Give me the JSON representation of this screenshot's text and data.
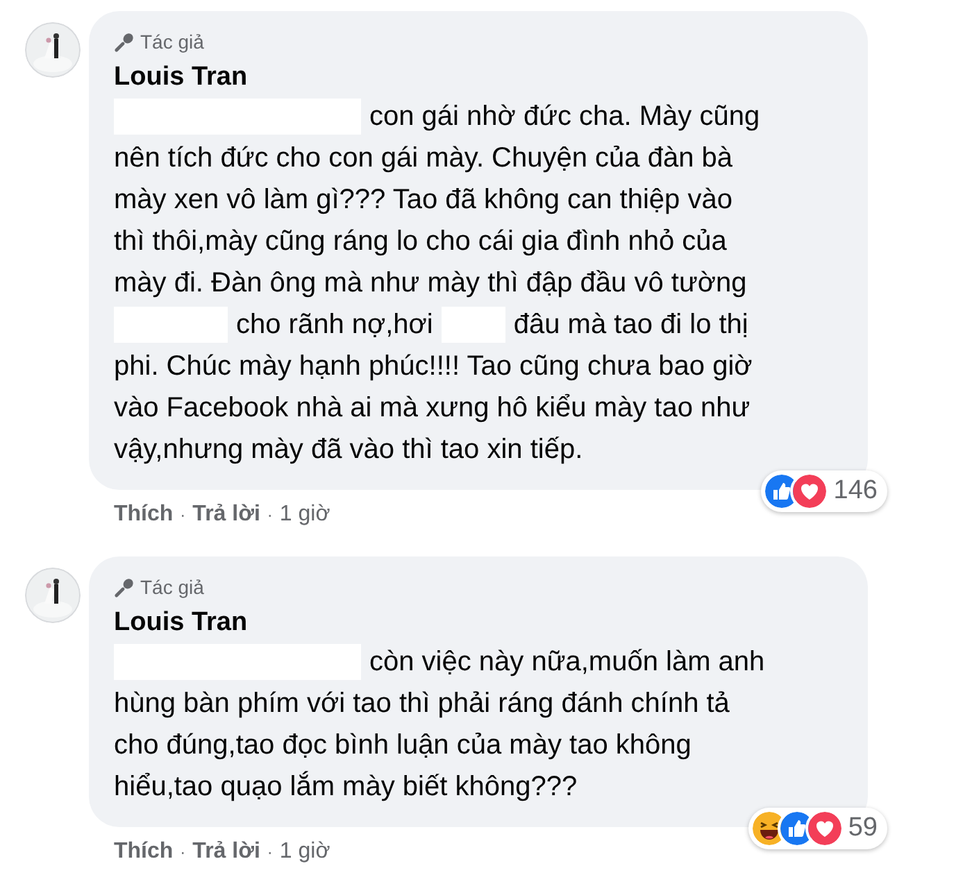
{
  "comments": [
    {
      "badge": "Tác giả",
      "author": "Louis Tran",
      "lines": [
        [
          {
            "kind": "redacted_wide"
          },
          {
            "kind": "text",
            "text": "con gái nhờ đức cha. Mày cũng"
          }
        ],
        [
          {
            "kind": "text",
            "text": "nên tích đức cho con gái mày. Chuyện của đàn bà"
          }
        ],
        [
          {
            "kind": "text",
            "text": "mày xen vô làm gì??? Tao đã không can thiệp vào"
          }
        ],
        [
          {
            "kind": "text",
            "text": "thì thôi,mày cũng ráng lo cho cái gia đình nhỏ của"
          }
        ],
        [
          {
            "kind": "text",
            "text": "mày đi. Đàn ông mà như mày thì đập đầu vô tường"
          }
        ],
        [
          {
            "kind": "redacted_mid"
          },
          {
            "kind": "text",
            "text": "cho rãnh nợ,hơi"
          },
          {
            "kind": "redacted_narrow"
          },
          {
            "kind": "text",
            "text": "đâu mà tao đi lo thị"
          }
        ],
        [
          {
            "kind": "text",
            "text": "phi. Chúc mày hạnh phúc!!!! Tao cũng chưa bao giờ"
          }
        ],
        [
          {
            "kind": "text",
            "text": "vào Facebook nhà ai mà xưng hô kiểu mày tao như"
          }
        ],
        [
          {
            "kind": "text",
            "text": "vậy,nhưng mày đã vào thì tao xin tiếp."
          }
        ]
      ],
      "reactions": [
        {
          "kind": "like"
        },
        {
          "kind": "love"
        }
      ],
      "reaction_count": "146",
      "actions": [
        {
          "kind": "like",
          "text": "Thích"
        },
        {
          "kind": "separator",
          "text": "·"
        },
        {
          "kind": "reply",
          "text": "Trả lời"
        },
        {
          "kind": "separator",
          "text": "·"
        },
        {
          "kind": "time",
          "text": "1 giờ"
        }
      ]
    },
    {
      "badge": "Tác giả",
      "author": "Louis Tran",
      "lines": [
        [
          {
            "kind": "redacted_wide"
          },
          {
            "kind": "text",
            "text": "còn việc này nữa,muốn làm anh"
          }
        ],
        [
          {
            "kind": "text",
            "text": "hùng bàn phím với tao thì phải ráng đánh chính tả"
          }
        ],
        [
          {
            "kind": "text",
            "text": "cho đúng,tao đọc bình luận của mày tao không"
          }
        ],
        [
          {
            "kind": "text",
            "text": "hiểu,tao quạo lắm mày biết không???"
          }
        ]
      ],
      "reactions": [
        {
          "kind": "haha"
        },
        {
          "kind": "like"
        },
        {
          "kind": "love"
        }
      ],
      "reaction_count": "59",
      "actions": [
        {
          "kind": "like",
          "text": "Thích"
        },
        {
          "kind": "separator",
          "text": "·"
        },
        {
          "kind": "reply",
          "text": "Trả lời"
        },
        {
          "kind": "separator",
          "text": "·"
        },
        {
          "kind": "time",
          "text": "1 giờ"
        }
      ]
    }
  ]
}
